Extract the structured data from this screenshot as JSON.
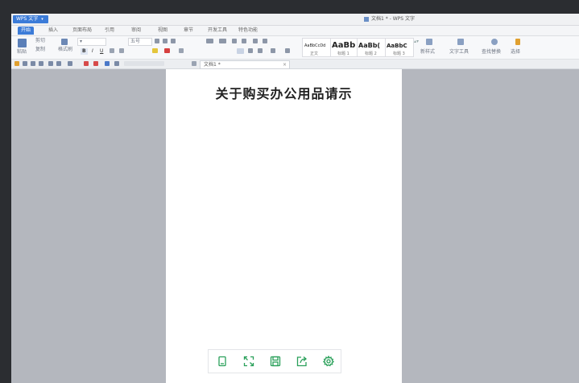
{
  "app": {
    "menu_label": "WPS 文字",
    "menu_arrow": "▾",
    "document_title": "文档1 * - WPS 文字"
  },
  "tabs": [
    {
      "label": "开始",
      "active": true
    },
    {
      "label": "插入",
      "active": false
    },
    {
      "label": "页面布局",
      "active": false
    },
    {
      "label": "引用",
      "active": false
    },
    {
      "label": "审阅",
      "active": false
    },
    {
      "label": "视图",
      "active": false
    },
    {
      "label": "章节",
      "active": false
    },
    {
      "label": "开发工具",
      "active": false
    },
    {
      "label": "特色功能",
      "active": false
    }
  ],
  "ribbon": {
    "paste_label": "粘贴",
    "cut_label": "剪切",
    "copy_label": "复制",
    "format_painter_label": "格式刷",
    "font_size": "五号",
    "bold": "B",
    "italic": "I",
    "underline": "U",
    "styles": [
      {
        "preview": "AaBbCcDd",
        "label": "正文"
      },
      {
        "preview": "AaBb",
        "label": "标题 1"
      },
      {
        "preview": "AaBb(",
        "label": "标题 2"
      },
      {
        "preview": "AaBbC",
        "label": "标题 3"
      }
    ],
    "new_style_label": "新样式",
    "text_tool_label": "文字工具",
    "find_replace_label": "查找替换",
    "select_label": "选择"
  },
  "document_tab": {
    "label": "文档1 *",
    "close": "×"
  },
  "page": {
    "title": "关于购买办公用品请示"
  },
  "colors": {
    "accent": "#3b7bd8",
    "workspace": "#b4b7be",
    "toolbar_icon": "#2aa05a"
  }
}
